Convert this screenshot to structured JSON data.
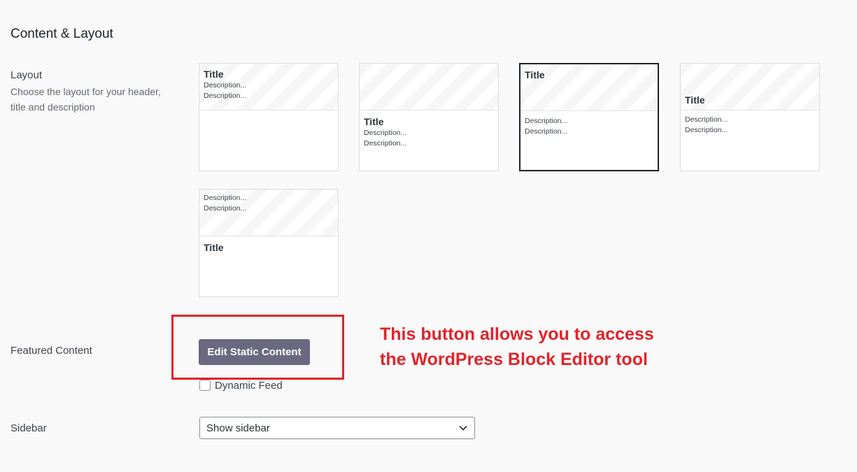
{
  "section_title": "Content & Layout",
  "layout": {
    "label": "Layout",
    "description": "Choose the layout for your header, title and description",
    "options": [
      {
        "title": "Title",
        "desc1": "Description...",
        "desc2": "Description...",
        "selected": false
      },
      {
        "title": "Title",
        "desc1": "Description...",
        "desc2": "Description...",
        "selected": false
      },
      {
        "title": "Title",
        "desc1": "Description...",
        "desc2": "Description...",
        "selected": true
      },
      {
        "title": "Title",
        "desc1": "Description...",
        "desc2": "Description...",
        "selected": false
      },
      {
        "title": "Title",
        "desc1": "Description...",
        "desc2": "Description...",
        "selected": false
      }
    ]
  },
  "featured": {
    "label": "Featured Content",
    "button_label": "Edit Static Content",
    "checkbox_label": "Dynamic Feed",
    "checkbox_checked": false
  },
  "annotation": {
    "line1": "This button allows you to access",
    "line2": "the WordPress Block Editor tool",
    "color": "#e2232b"
  },
  "sidebar": {
    "label": "Sidebar",
    "selected_value": "Show sidebar"
  },
  "icons": {
    "select_arrow": "chevron-down-icon"
  }
}
